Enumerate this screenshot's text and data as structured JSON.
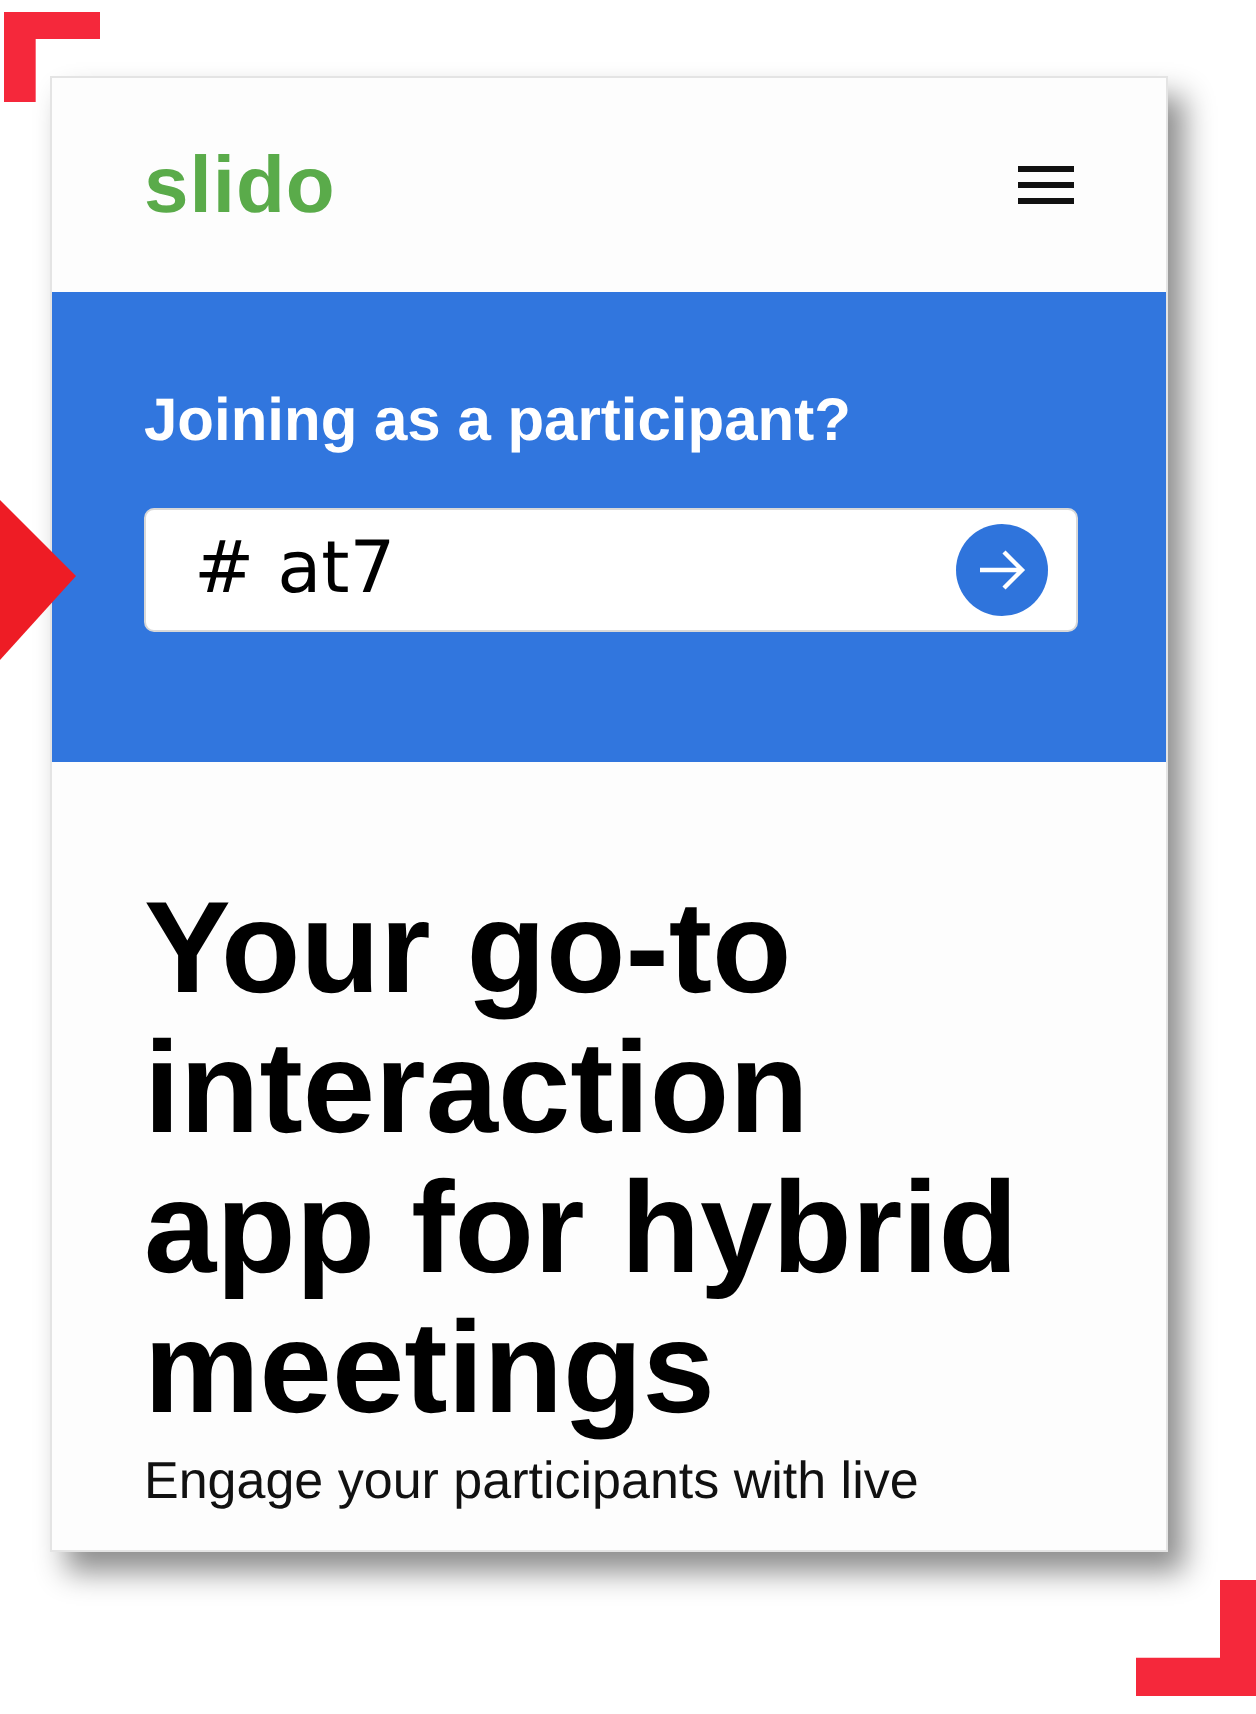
{
  "header": {
    "logo": "slido"
  },
  "join": {
    "title": "Joining as a participant?",
    "value": "# at7"
  },
  "hero": {
    "headline": "Your go-to interaction app for hybrid meetings",
    "intro": "Engage your participants with live"
  }
}
